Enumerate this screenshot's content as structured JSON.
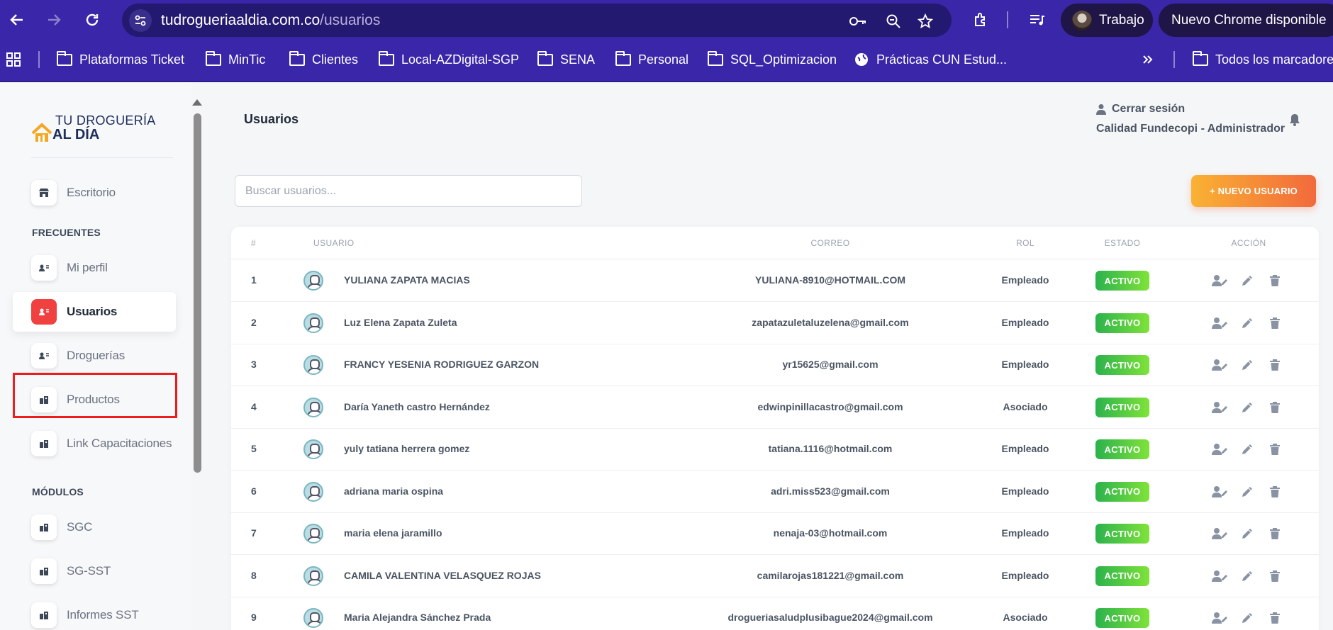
{
  "browser": {
    "url_host": "tudrogueriaaldia.com.co",
    "url_path": "/usuarios",
    "profile": "Trabajo",
    "update": "Nuevo Chrome disponible"
  },
  "bookmarks": [
    {
      "label": "Plataformas Ticket",
      "icon": "folder-icon"
    },
    {
      "label": "MinTic",
      "icon": "folder-icon"
    },
    {
      "label": "Clientes",
      "icon": "folder-icon"
    },
    {
      "label": "Local-AZDigital-SGP",
      "icon": "folder-icon"
    },
    {
      "label": "SENA",
      "icon": "folder-icon"
    },
    {
      "label": "Personal",
      "icon": "folder-icon"
    },
    {
      "label": "SQL_Optimizacion",
      "icon": "folder-icon"
    },
    {
      "label": "Prácticas CUN Estud...",
      "icon": "globe-icon"
    }
  ],
  "all_bookmarks": "Todos los marcadores",
  "logo": {
    "line1": "TU DROGUERÍA",
    "line2": "AL DÍA"
  },
  "sidebar": {
    "top_item": {
      "label": "Escritorio",
      "icon": "store-icon"
    },
    "section_frequent": "FRECUENTES",
    "frequent": [
      {
        "label": "Mi perfil",
        "icon": "user-card-icon"
      },
      {
        "label": "Usuarios",
        "icon": "user-card-icon"
      },
      {
        "label": "Droguerías",
        "icon": "user-card-icon"
      },
      {
        "label": "Productos",
        "icon": "building-icon"
      },
      {
        "label": "Link Capacitaciones",
        "icon": "building-icon"
      }
    ],
    "section_modules": "MÓDULOS",
    "modules": [
      {
        "label": "SGC",
        "icon": "building-icon"
      },
      {
        "label": "SG-SST",
        "icon": "building-icon"
      },
      {
        "label": "Informes SST",
        "icon": "building-icon"
      }
    ]
  },
  "header": {
    "title": "Usuarios",
    "logout": "Cerrar sesión",
    "user": "Calidad Fundecopi - Administrador"
  },
  "search": {
    "placeholder": "Buscar usuarios..."
  },
  "new_user_button": "+ NUEVO USUARIO",
  "table": {
    "columns": [
      "#",
      "USUARIO",
      "CORREO",
      "ROL",
      "ESTADO",
      "ACCIÓN"
    ],
    "rows": [
      {
        "n": "1",
        "name": "YULIANA ZAPATA MACIAS",
        "email": "YULIANA-8910@HOTMAIL.COM",
        "role": "Empleado",
        "status": "ACTIVO"
      },
      {
        "n": "2",
        "name": "Luz Elena Zapata Zuleta",
        "email": "zapatazuletaluzelena@gmail.com",
        "role": "Empleado",
        "status": "ACTIVO"
      },
      {
        "n": "3",
        "name": "FRANCY YESENIA RODRIGUEZ GARZON",
        "email": "yr15625@gmail.com",
        "role": "Empleado",
        "status": "ACTIVO"
      },
      {
        "n": "4",
        "name": "Daría Yaneth castro Hernández",
        "email": "edwinpinillacastro@gmail.com",
        "role": "Asociado",
        "status": "ACTIVO"
      },
      {
        "n": "5",
        "name": "yuly tatiana herrera gomez",
        "email": "tatiana.1116@hotmail.com",
        "role": "Empleado",
        "status": "ACTIVO"
      },
      {
        "n": "6",
        "name": "adriana maria ospina",
        "email": "adri.miss523@gmail.com",
        "role": "Empleado",
        "status": "ACTIVO"
      },
      {
        "n": "7",
        "name": "maria elena jaramillo",
        "email": "nenaja-03@hotmail.com",
        "role": "Empleado",
        "status": "ACTIVO"
      },
      {
        "n": "8",
        "name": "CAMILA VALENTINA VELASQUEZ ROJAS",
        "email": "camilarojas181221@gmail.com",
        "role": "Empleado",
        "status": "ACTIVO"
      },
      {
        "n": "9",
        "name": "Maria Alejandra Sánchez Prada",
        "email": "drogueriasaludplusibague2024@gmail.com",
        "role": "Asociado",
        "status": "ACTIVO"
      }
    ],
    "row_actions": [
      "assign-user-icon",
      "edit-pencil-icon",
      "trash-icon"
    ]
  },
  "colors": {
    "chrome": "#3a26a8",
    "accent_red": "#f04040",
    "active_badge": "#2bb24c",
    "new_button": "#f2693c"
  }
}
